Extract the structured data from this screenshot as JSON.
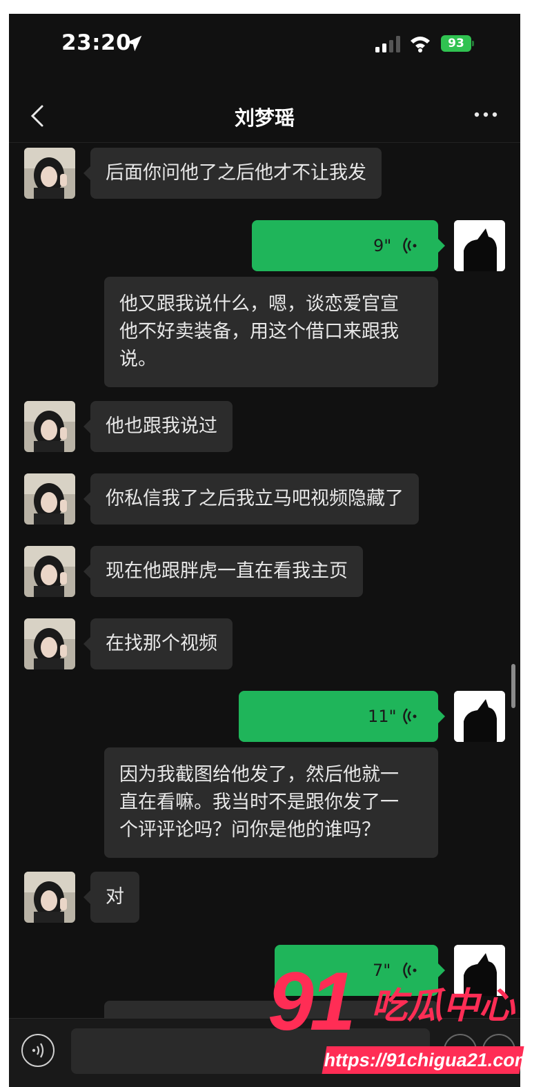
{
  "status_bar": {
    "time": "23:20",
    "battery": "93"
  },
  "header": {
    "title": "刘梦瑶"
  },
  "messages": [
    {
      "text": "后面你问他了之后他才不让我发"
    },
    {
      "duration": "9\"",
      "transcript_l1": "他又跟我说什么，嗯，谈恋爱官宣",
      "transcript_l2": "他不好卖装备，用这个借口来跟我",
      "transcript_l3": "说。"
    },
    {
      "text": "他也跟我说过"
    },
    {
      "text": "你私信我了之后我立马吧视频隐藏了"
    },
    {
      "text": "现在他跟胖虎一直在看我主页"
    },
    {
      "text": "在找那个视频"
    },
    {
      "duration": "11\"",
      "transcript_l1": "因为我截图给他发了，然后他就一",
      "transcript_l2": "直在看嘛。我当时不是跟你发了一",
      "transcript_l3": "个评评论吗？问你是他的谁吗？"
    },
    {
      "text": "对"
    },
    {
      "duration": "7\""
    }
  ],
  "watermark": {
    "logo_num": "91",
    "logo_text": "吃瓜中心",
    "url": "https://91chigua21.com"
  }
}
